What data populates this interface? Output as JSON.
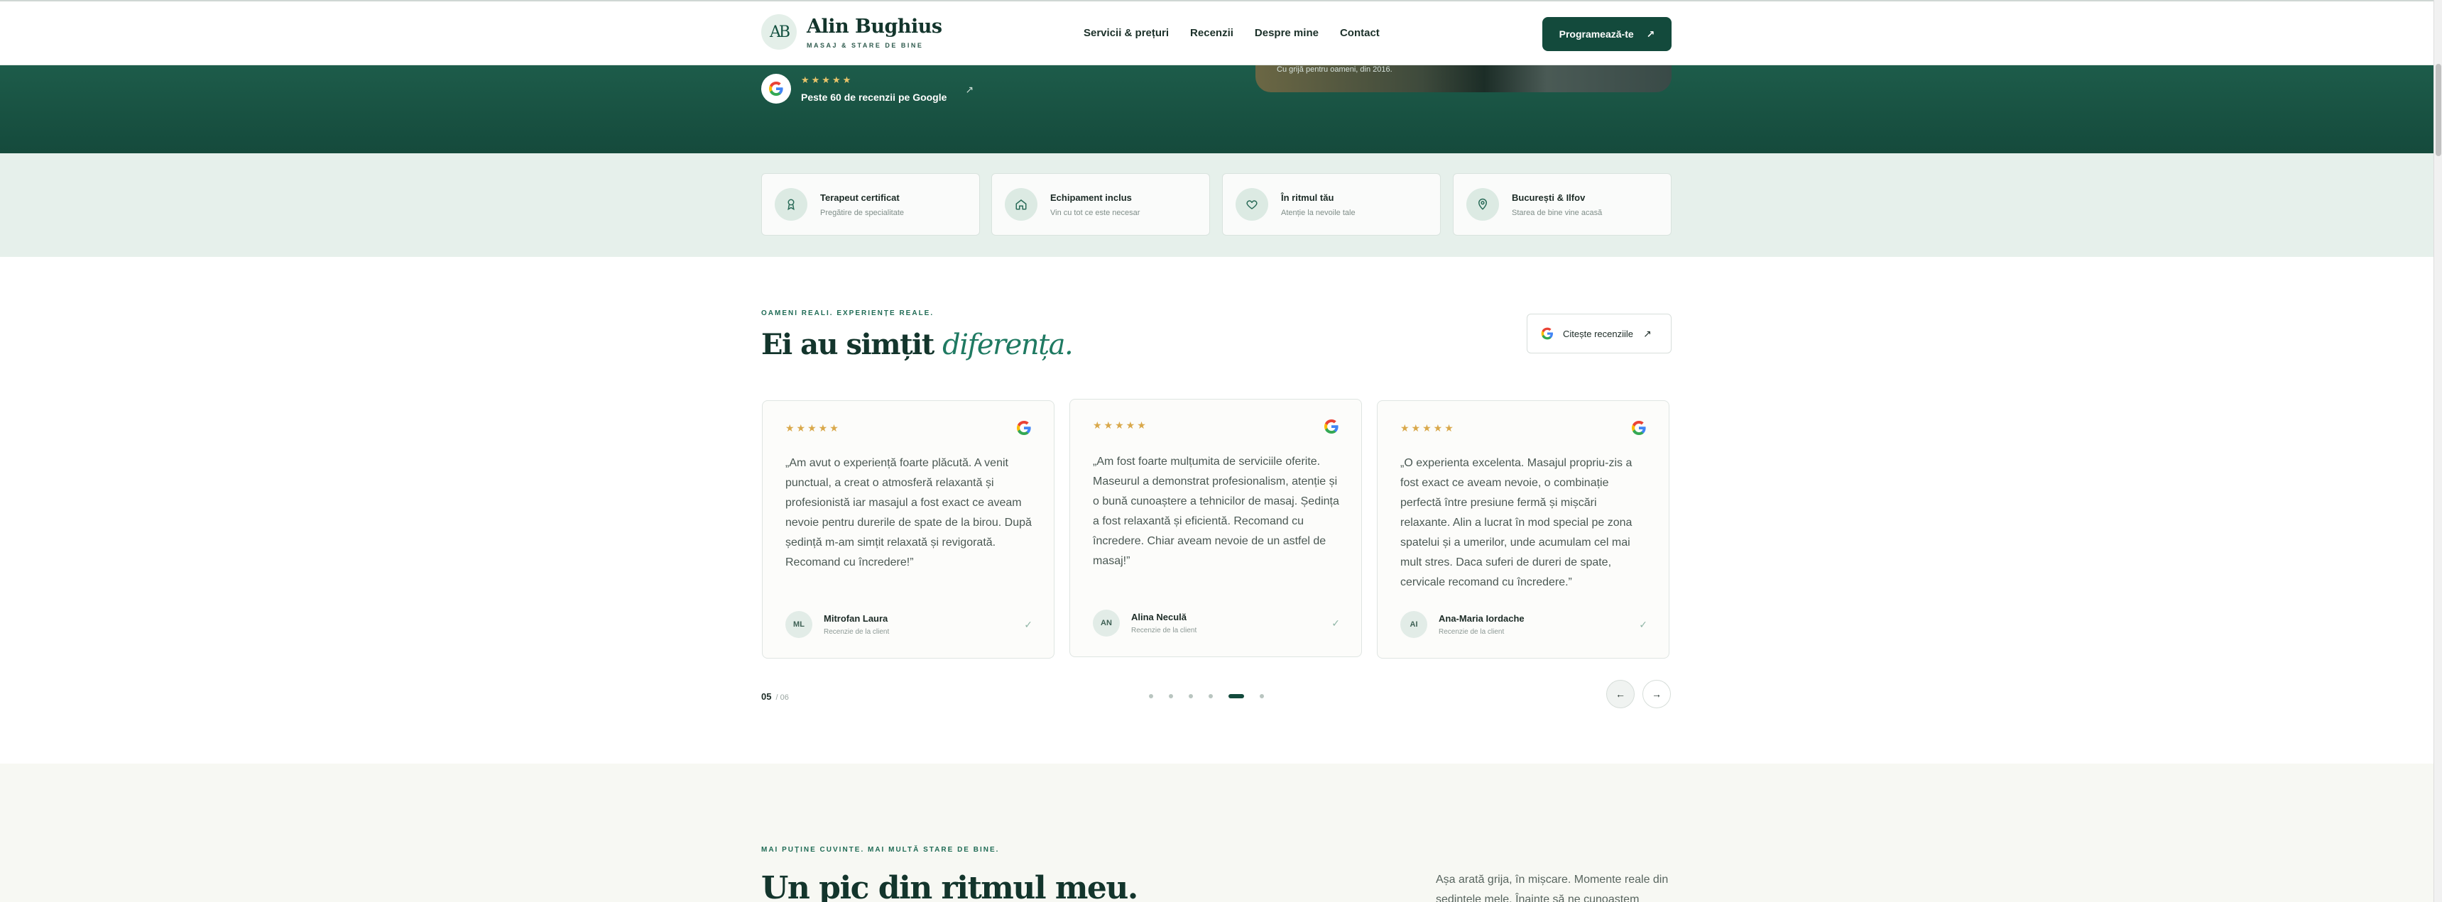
{
  "header": {
    "logo_mark": "AB",
    "logo_title": "Alin Bughius",
    "logo_sub": "MASAJ & STARE DE BINE",
    "nav": [
      "Servicii & prețuri",
      "Recenzii",
      "Despre mine",
      "Contact"
    ],
    "cta_label": "Programează-te"
  },
  "hero": {
    "photo_caption": "Cu grijă pentru oameni, din 2016.",
    "google_stars": "★★★★★",
    "google_reviews": "Peste 60 de recenzii pe Google"
  },
  "features": [
    {
      "title": "Terapeut certificat",
      "desc": "Pregătire de specialitate",
      "icon": "award-icon"
    },
    {
      "title": "Echipament inclus",
      "desc": "Vin cu tot ce este necesar",
      "icon": "home-icon"
    },
    {
      "title": "În ritmul tău",
      "desc": "Atenție la nevoile tale",
      "icon": "heart-icon"
    },
    {
      "title": "București & Ilfov",
      "desc": "Starea de bine vine acasă",
      "icon": "location-pin-icon"
    }
  ],
  "reviews": {
    "kicker": "OAMENI REALI. EXPERIENȚE REALE.",
    "heading_main": "Ei au simțit ",
    "heading_accent": "diferența.",
    "read_button": "Citește recenziile",
    "cards": [
      {
        "stars": "★★★★★",
        "text": "„Am avut o experiență foarte plăcută. A venit punctual, a creat o atmosferă relaxantă și profesionistă iar masajul a fost exact ce aveam nevoie pentru durerile de spate de la birou. După ședință m-am simțit relaxată și revigorată. Recomand cu încredere!”",
        "initials": "ML",
        "name": "Mitrofan Laura",
        "source": "Recenzie de la client"
      },
      {
        "stars": "★★★★★",
        "text": "„Am fost foarte mulțumita de serviciile oferite. Maseurul a demonstrat profesionalism, atenție și o bună cunoaștere a tehnicilor de masaj. Ședința a fost relaxantă și eficientă. Recomand cu încredere. Chiar aveam nevoie de un astfel de masaj!”",
        "initials": "AN",
        "name": "Alina Neculă",
        "source": "Recenzie de la client"
      },
      {
        "stars": "★★★★★",
        "text": "„O experienta excelenta. Masajul propriu-zis a fost exact ce aveam nevoie, o combinație perfectă între presiune fermă și mișcări relaxante. Alin a lucrat în mod special pe zona spatelui și a umerilor, unde acumulam cel mai mult stres. Daca suferi de dureri de spate, cervicale recomand cu încredere.”",
        "initials": "AI",
        "name": "Ana-Maria Iordache",
        "source": "Recenzie de la client"
      }
    ],
    "pager_current": "05",
    "pager_total": "/ 06",
    "prev_label": "←",
    "next_label": "→"
  },
  "next_section": {
    "kicker": "MAI PUȚINE CUVINTE. MAI MULTĂ STARE DE BINE.",
    "heading": "Un pic din ritmul meu.",
    "paragraph": "Așa arată grija, în mișcare. Momente reale din ședințele mele. Înainte să ne cunoaștem"
  }
}
